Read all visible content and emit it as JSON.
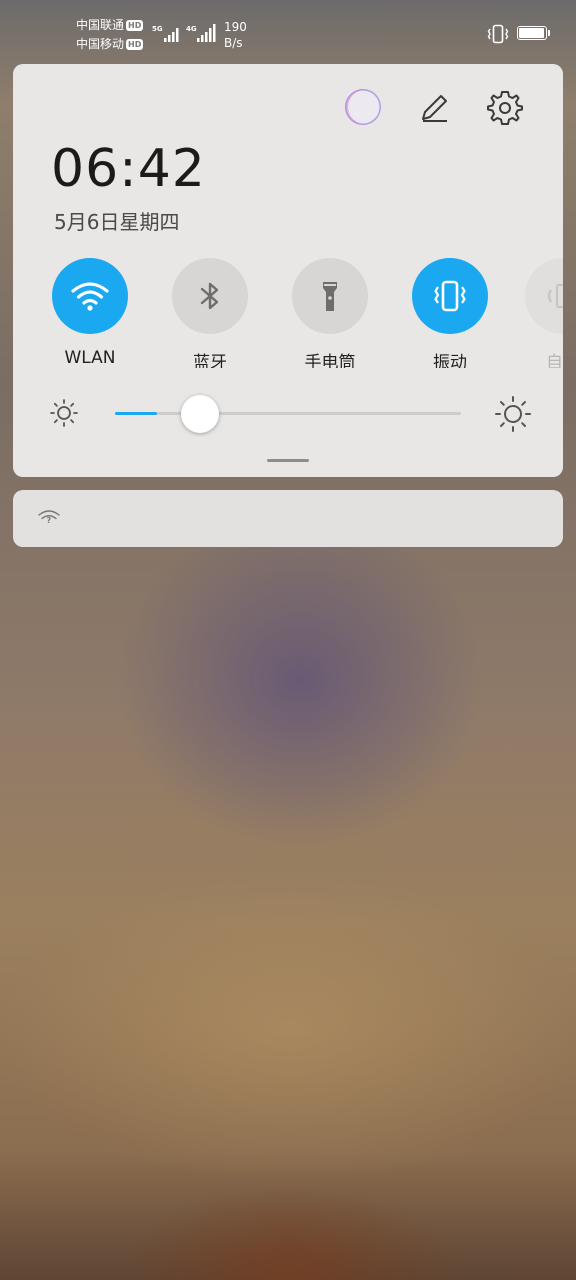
{
  "status_bar": {
    "carrier1": "中国联通",
    "carrier2": "中国移动",
    "hd_badge": "HD",
    "net_5g": "5G",
    "net_4g": "4G",
    "speed_value": "190",
    "speed_unit": "B/s",
    "battery_level": 0.95,
    "icons": [
      "signal-icon",
      "vibrate-status-icon",
      "battery-icon"
    ]
  },
  "panel": {
    "time": "06:42",
    "date": "5月6日星期四",
    "header_icons": [
      "avatar",
      "edit-icon",
      "settings-icon"
    ],
    "toggles": [
      {
        "label": "WLAN",
        "icon": "wifi-icon",
        "state": "on"
      },
      {
        "label": "蓝牙",
        "icon": "bluetooth-icon",
        "state": "off"
      },
      {
        "label": "手电筒",
        "icon": "flashlight-icon",
        "state": "off"
      },
      {
        "label": "振动",
        "icon": "vibrate-icon",
        "state": "on"
      },
      {
        "label": "自动",
        "icon": "auto-rotate-icon",
        "state": "off"
      }
    ],
    "brightness": 0.12
  },
  "notification": {
    "icon": "wifi-unknown-icon"
  },
  "colors": {
    "accent": "#1aa8f0",
    "panel_bg": "#e9e7e5"
  }
}
